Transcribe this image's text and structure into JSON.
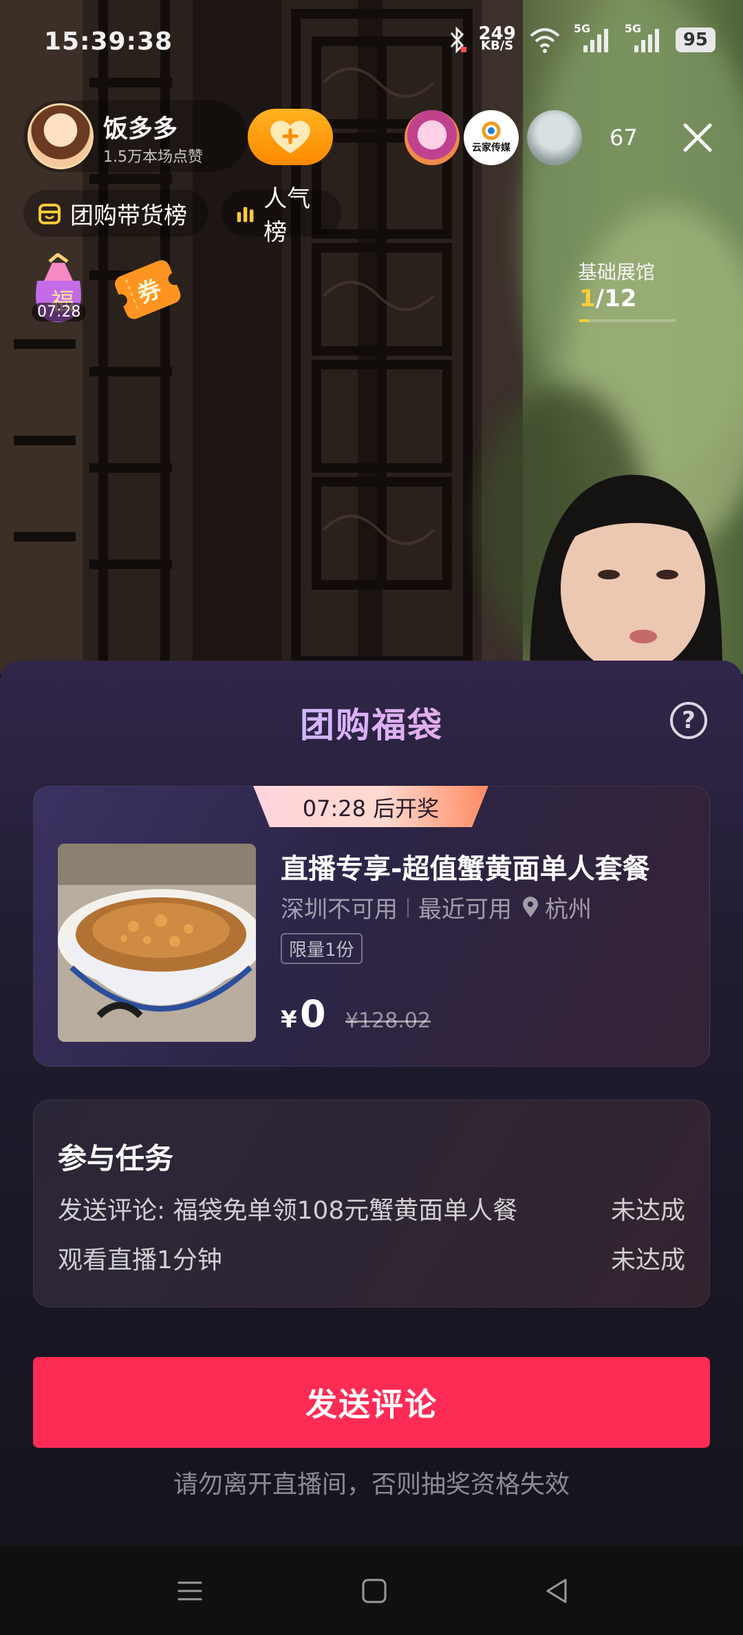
{
  "status_bar": {
    "time": "15:39:38",
    "net_speed_value": "249",
    "net_speed_unit": "KB/S",
    "signal_1": "5G",
    "signal_2": "5G",
    "battery": "95"
  },
  "anchor": {
    "name": "饭多多",
    "likes": "1.5万本场点赞",
    "viewer_count": "67",
    "viewer_brand": "云家传媒"
  },
  "rank_chips": {
    "group_buy_rank": "团购带货榜",
    "popularity_rank": "人气榜"
  },
  "activities": {
    "lucky_bag_timer": "07:28",
    "lucky_bag_glyph": "福",
    "coupon_glyph": "券"
  },
  "exhibit": {
    "label": "基础展馆",
    "current": "1",
    "total": "/12"
  },
  "sheet": {
    "title": "团购福袋",
    "help": "?",
    "draw_tag": "07:28 后开奖",
    "product": {
      "name": "直播专享-超值蟹黄面单人套餐",
      "availability": "深圳不可用",
      "recent": "最近可用",
      "city": "杭州",
      "limit": "限量1份",
      "currency": "¥",
      "price": "0",
      "original_price": "¥128.02"
    },
    "tasks": {
      "heading": "参与任务",
      "items": [
        {
          "label": "发送评论: 福袋免单领108元蟹黄面单人餐",
          "status": "未达成"
        },
        {
          "label": "观看直播1分钟",
          "status": "未达成"
        }
      ]
    },
    "send_button": "发送评论",
    "warning": "请勿离开直播间，否则抽奖资格失效"
  },
  "colors": {
    "primary_button": "#fe2c55",
    "follow_button": "#ff9a0e",
    "accent_yellow": "#ffcf3a"
  }
}
